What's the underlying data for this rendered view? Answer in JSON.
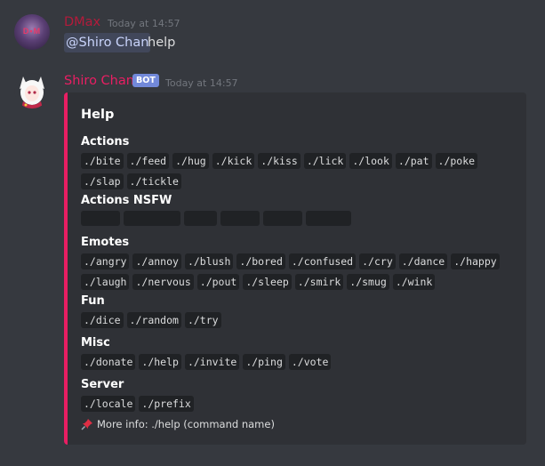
{
  "message1": {
    "username": "DMax",
    "username_color": "#b31b3b",
    "timestamp": "Today at 14:57",
    "mention": "@Shiro Chan",
    "text": "help",
    "avatar_icon": "avatar-dmax"
  },
  "message2": {
    "username": "Shiro Chan",
    "username_color": "#e91e63",
    "bot_tag": "BOT",
    "timestamp": "Today at 14:57",
    "avatar_icon": "avatar-shiro-chan",
    "embed": {
      "accent_color": "#e91e63",
      "title": "Help",
      "fields": [
        {
          "name": "Actions",
          "values": [
            "./bite",
            "./feed",
            "./hug",
            "./kick",
            "./kiss",
            "./lick",
            "./look",
            "./pat",
            "./poke",
            "./slap",
            "./tickle"
          ]
        },
        {
          "name": "Actions NSFW",
          "spoiler_count": 6
        },
        {
          "name": "Emotes",
          "values": [
            "./angry",
            "./annoy",
            "./blush",
            "./bored",
            "./confused",
            "./cry",
            "./dance",
            "./happy",
            "./laugh",
            "./nervous",
            "./pout",
            "./sleep",
            "./smirk",
            "./smug",
            "./wink"
          ]
        },
        {
          "name": "Fun",
          "values": [
            "./dice",
            "./random",
            "./try"
          ]
        },
        {
          "name": "Misc",
          "values": [
            "./donate",
            "./help",
            "./invite",
            "./ping",
            "./vote"
          ]
        },
        {
          "name": "Server",
          "values": [
            "./locale",
            "./prefix"
          ]
        }
      ],
      "footer_icon": "pushpin-icon",
      "footer": "More info: ./help (command name)"
    }
  }
}
